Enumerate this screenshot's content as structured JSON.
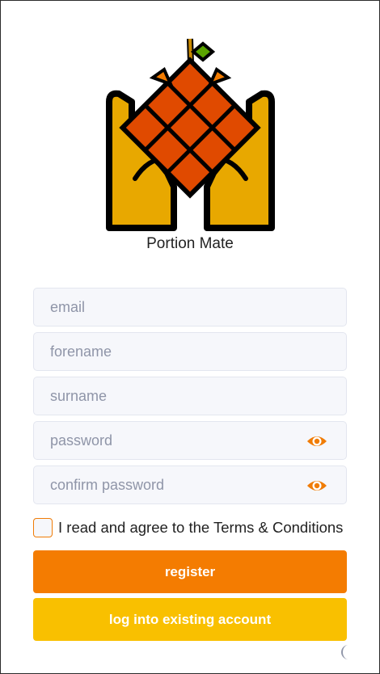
{
  "app": {
    "name": "Portion Mate"
  },
  "form": {
    "email_placeholder": "email",
    "forename_placeholder": "forename",
    "surname_placeholder": "surname",
    "password_placeholder": "password",
    "confirm_password_placeholder": "confirm password",
    "terms_label": "I read and agree to the Terms & Conditions"
  },
  "buttons": {
    "register_label": "register",
    "login_label": "log into existing account"
  },
  "icons": {
    "logo": "ketupat-hands-logo",
    "password_toggle": "eye-icon",
    "theme_toggle": "moon-icon"
  },
  "colors": {
    "primary": "#f47c01",
    "secondary": "#f9c000",
    "field_bg": "#f6f7fb",
    "placeholder": "#8f95a8"
  }
}
